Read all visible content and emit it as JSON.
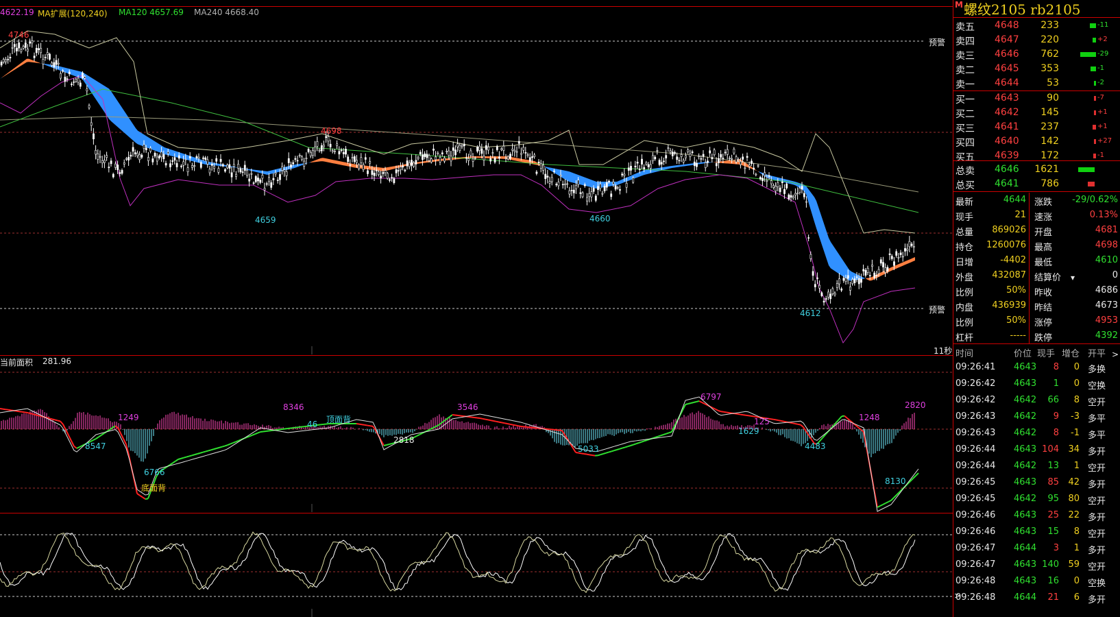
{
  "header": {
    "flag": "M",
    "title": "螺纹2105  rb2105",
    "ma_price": "4622.19",
    "ma_label": "MA扩展(120,240)",
    "ma120": "MA120 4657.69",
    "ma240": "MA240 4668.40"
  },
  "main_chart": {
    "price_labels": {
      "high": "4746",
      "p4698": "4698",
      "p4659": "4659",
      "p4660": "4660",
      "p4612": "4612"
    },
    "alert_top": "预警",
    "alert_bottom": "预警",
    "interval": "11秒"
  },
  "area_panel": {
    "label": "当前面积",
    "value": "281.96",
    "annotations": [
      "1249",
      "8547",
      "6766",
      "底面背",
      "8346",
      "46",
      "顶面背",
      "3546",
      "2818",
      "5033",
      "6797",
      "1629",
      "125",
      "1248",
      "4483",
      "2820",
      "8130"
    ]
  },
  "orderbook": {
    "asks": [
      {
        "label": "卖五",
        "price": "4648",
        "vol": "233",
        "chg": "-11",
        "bar": 0.35
      },
      {
        "label": "卖四",
        "price": "4647",
        "vol": "220",
        "chg": "+2",
        "bar": 0.2
      },
      {
        "label": "卖三",
        "price": "4646",
        "vol": "762",
        "chg": "-29",
        "bar": 0.9
      },
      {
        "label": "卖二",
        "price": "4645",
        "vol": "353",
        "chg": "-1",
        "bar": 0.3
      },
      {
        "label": "卖一",
        "price": "4644",
        "vol": "53",
        "chg": "-2",
        "bar": 0.05
      }
    ],
    "bids": [
      {
        "label": "买一",
        "price": "4643",
        "vol": "90",
        "chg": "-7",
        "bar": 0.08
      },
      {
        "label": "买二",
        "price": "4642",
        "vol": "145",
        "chg": "+1",
        "bar": 0.12
      },
      {
        "label": "买三",
        "price": "4641",
        "vol": "237",
        "chg": "+1",
        "bar": 0.2
      },
      {
        "label": "买四",
        "price": "4640",
        "vol": "142",
        "chg": "+27",
        "bar": 0.12
      },
      {
        "label": "买五",
        "price": "4639",
        "vol": "172",
        "chg": "-1",
        "bar": 0.14
      }
    ],
    "total_sell": {
      "label": "总卖",
      "price": "4646",
      "vol": "1621"
    },
    "total_buy": {
      "label": "总买",
      "price": "4641",
      "vol": "786"
    }
  },
  "quote": {
    "left": [
      {
        "label": "最新",
        "value": "4644"
      },
      {
        "label": "现手",
        "value": "21"
      },
      {
        "label": "总量",
        "value": "869026"
      },
      {
        "label": "持仓",
        "value": "1260076"
      },
      {
        "label": "日增",
        "value": "-4402"
      },
      {
        "label": "外盘",
        "value": "432087"
      },
      {
        "label": "比例",
        "value": "50%"
      },
      {
        "label": "内盘",
        "value": "436939"
      },
      {
        "label": "比例",
        "value": "50%"
      },
      {
        "label": "杠杆",
        "value": "-----"
      }
    ],
    "right": [
      {
        "label": "涨跌",
        "value": "-29/0.62%"
      },
      {
        "label": "速涨",
        "value": "0.13%"
      },
      {
        "label": "开盘",
        "value": "4681"
      },
      {
        "label": "最高",
        "value": "4698"
      },
      {
        "label": "最低",
        "value": "4610"
      },
      {
        "label": "结算价",
        "value": "0"
      },
      {
        "label": "昨收",
        "value": "4686"
      },
      {
        "label": "昨结",
        "value": "4673"
      },
      {
        "label": "涨停",
        "value": "4953"
      },
      {
        "label": "跌停",
        "value": "4392"
      }
    ]
  },
  "trades": {
    "headers": [
      "时间",
      "价位",
      "现手",
      "增仓",
      "开平"
    ],
    "rows": [
      {
        "time": "09:26:41",
        "price": "4643",
        "vol": "8",
        "oi": "0",
        "type": "多换"
      },
      {
        "time": "09:26:42",
        "price": "4643",
        "vol": "1",
        "oi": "0",
        "type": "空换"
      },
      {
        "time": "09:26:42",
        "price": "4642",
        "vol": "66",
        "oi": "8",
        "type": "空开"
      },
      {
        "time": "09:26:43",
        "price": "4642",
        "vol": "9",
        "oi": "-3",
        "type": "多平"
      },
      {
        "time": "09:26:43",
        "price": "4642",
        "vol": "8",
        "oi": "-1",
        "type": "多平"
      },
      {
        "time": "09:26:44",
        "price": "4643",
        "vol": "104",
        "oi": "34",
        "type": "多开"
      },
      {
        "time": "09:26:44",
        "price": "4642",
        "vol": "13",
        "oi": "1",
        "type": "空开"
      },
      {
        "time": "09:26:45",
        "price": "4643",
        "vol": "85",
        "oi": "42",
        "type": "多开"
      },
      {
        "time": "09:26:45",
        "price": "4642",
        "vol": "95",
        "oi": "80",
        "type": "空开"
      },
      {
        "time": "09:26:46",
        "price": "4643",
        "vol": "25",
        "oi": "22",
        "type": "多开"
      },
      {
        "time": "09:26:46",
        "price": "4643",
        "vol": "15",
        "oi": "8",
        "type": "空开"
      },
      {
        "time": "09:26:47",
        "price": "4644",
        "vol": "3",
        "oi": "1",
        "type": "多开"
      },
      {
        "time": "09:26:47",
        "price": "4643",
        "vol": "140",
        "oi": "59",
        "type": "空开"
      },
      {
        "time": "09:26:48",
        "price": "4643",
        "vol": "16",
        "oi": "0",
        "type": "空换"
      },
      {
        "time": "09:26:48",
        "price": "4644",
        "vol": "21",
        "oi": "6",
        "type": "多开"
      }
    ]
  },
  "colors": {
    "up": "#ff4040",
    "down": "#30e030",
    "accent": "#f0d020",
    "border": "#cc0000"
  }
}
